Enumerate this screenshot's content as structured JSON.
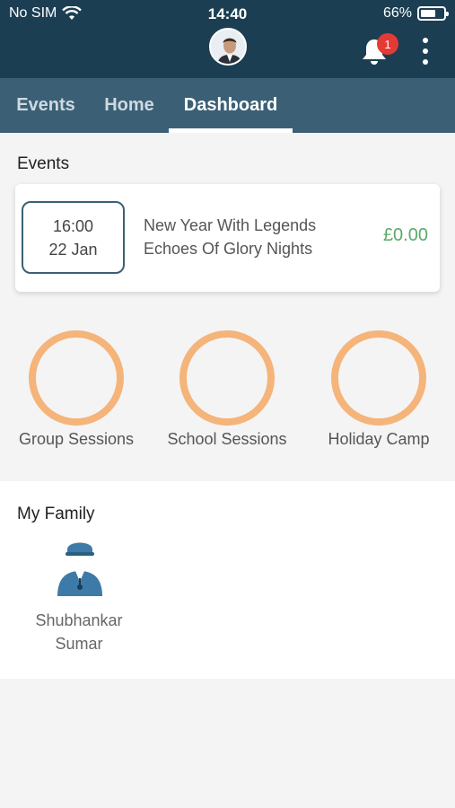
{
  "status_bar": {
    "carrier": "No SIM",
    "time": "14:40",
    "battery_percent": "66%",
    "battery_level": 0.66
  },
  "header": {
    "notification_count": "1"
  },
  "tabs": [
    {
      "label": "Events",
      "active": false
    },
    {
      "label": "Home",
      "active": false
    },
    {
      "label": "Dashboard",
      "active": true
    }
  ],
  "events": {
    "title": "Events",
    "items": [
      {
        "time": "16:00",
        "date": "22 Jan",
        "names": [
          "New Year With Legends",
          "Echoes Of Glory Nights"
        ],
        "price": "£0.00"
      }
    ]
  },
  "sessions": [
    {
      "label": "Group Sessions"
    },
    {
      "label": "School Sessions"
    },
    {
      "label": "Holiday Camp"
    }
  ],
  "family": {
    "title": "My Family",
    "members": [
      {
        "first_name": "Shubhankar",
        "last_name": "Sumar"
      }
    ]
  },
  "colors": {
    "header_bg": "#1c3e53",
    "tab_bg": "#3b6076",
    "ring": "#f5b47a",
    "price": "#5aaa6a",
    "badge": "#e53935",
    "member_icon": "#3e7aa8"
  }
}
